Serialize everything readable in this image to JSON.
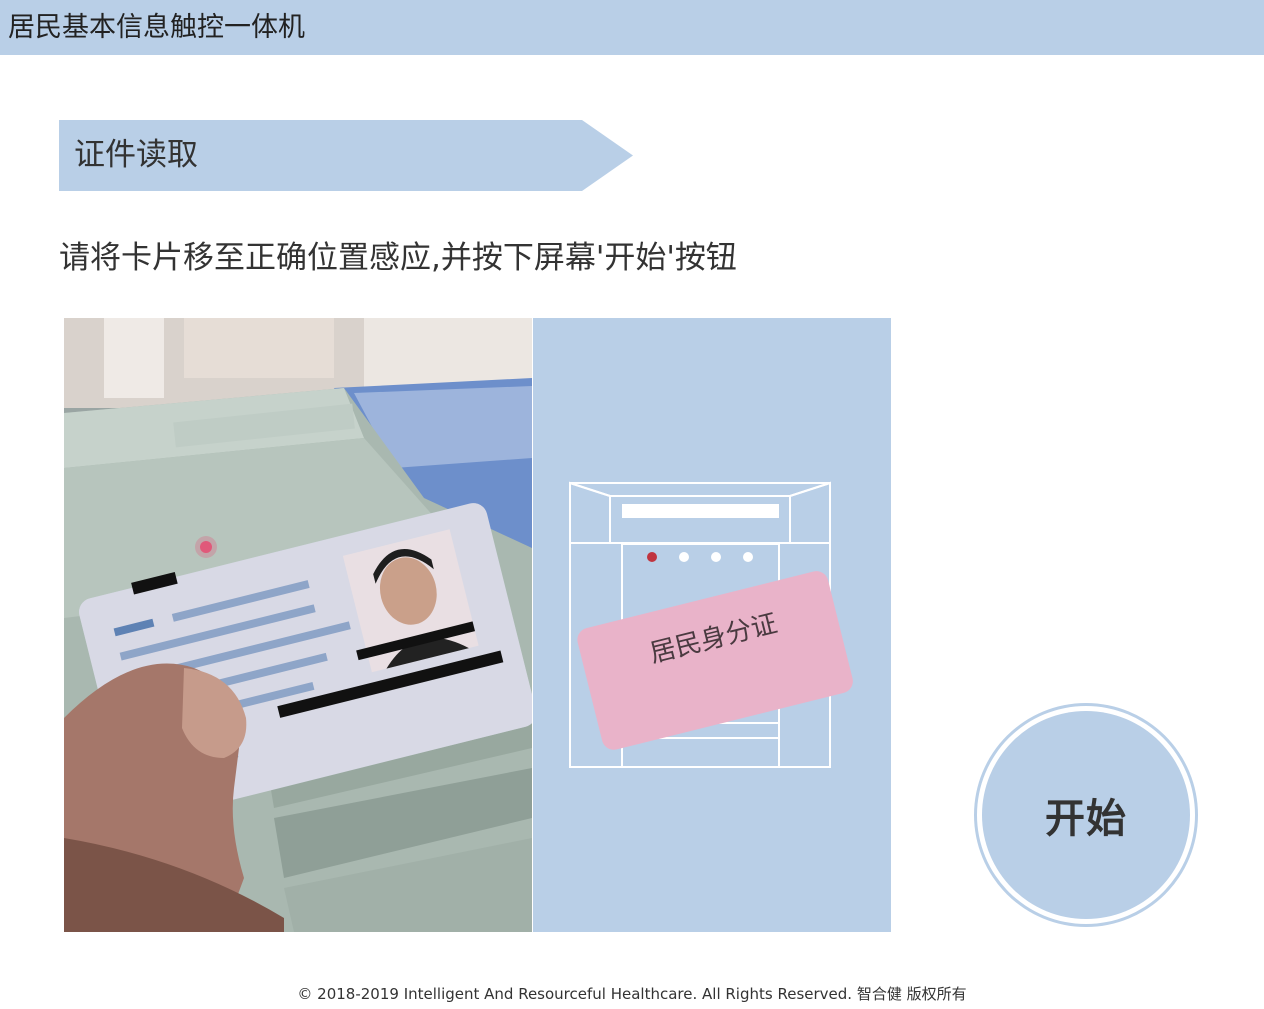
{
  "header": {
    "title": "居民基本信息触控一体机"
  },
  "section": {
    "title": "证件读取"
  },
  "instruction": "请将卡片移至正确位置感应,并按下屏幕'开始'按钮",
  "illustration": {
    "card_label": "居民身分证"
  },
  "start_button": {
    "label": "开始"
  },
  "footer": {
    "copyright": "© 2018-2019 Intelligent And Resourceful Healthcare. All Rights Reserved. 智合健 版权所有"
  },
  "colors": {
    "accent": "#b9cfe7",
    "card_pink": "#e9b3c9",
    "indicator_red": "#c0343f"
  }
}
